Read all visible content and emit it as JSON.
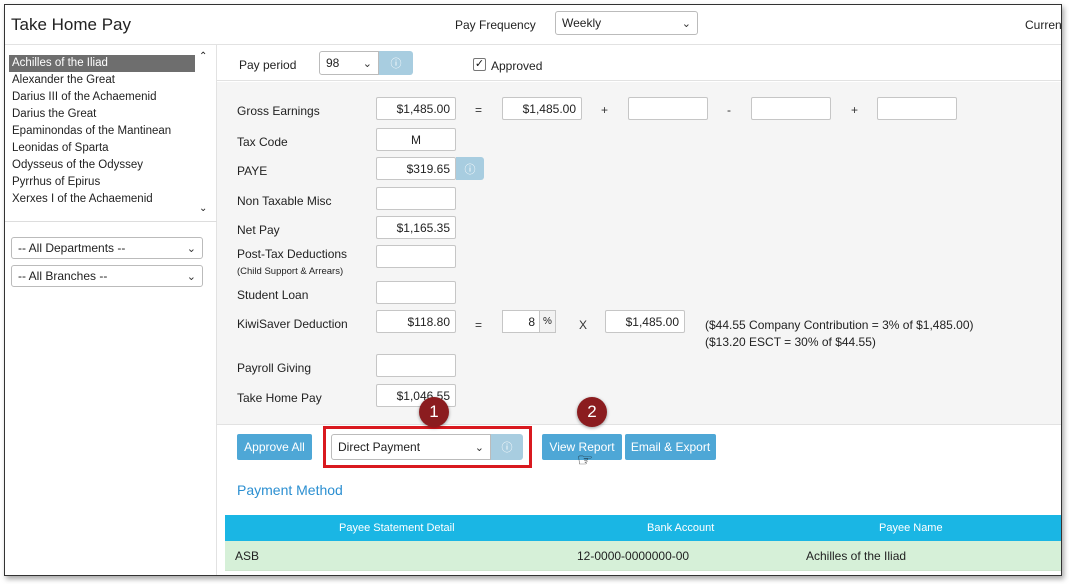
{
  "header": {
    "title": "Take Home Pay",
    "pay_frequency_label": "Pay Frequency",
    "pay_frequency_value": "Weekly",
    "currency_label": "Curren"
  },
  "sidebar": {
    "employees": [
      "Achilles of the Iliad",
      "Alexander the Great",
      "Darius III of the Achaemenid",
      "Darius the Great",
      "Epaminondas of the Mantinean",
      "Leonidas of Sparta",
      "Odysseus of the Odyssey",
      "Pyrrhus of Epirus",
      "Xerxes I of the Achaemenid"
    ],
    "selected_index": 0,
    "department_filter": "-- All Departments --",
    "branch_filter": "-- All Branches --"
  },
  "pay_period": {
    "label": "Pay period",
    "value": "98",
    "approved_label": "Approved",
    "approved": true
  },
  "calc": {
    "gross_earnings": {
      "label": "Gross Earnings",
      "value": "$1,485.00",
      "eq_value": "$1,485.00",
      "add1": "",
      "sub": "",
      "add2": ""
    },
    "tax_code": {
      "label": "Tax Code",
      "value": "M"
    },
    "paye": {
      "label": "PAYE",
      "value": "$319.65"
    },
    "non_taxable_misc": {
      "label": "Non Taxable Misc",
      "value": ""
    },
    "net_pay": {
      "label": "Net Pay",
      "value": "$1,165.35"
    },
    "post_tax_deductions": {
      "label": "Post-Tax Deductions",
      "sublabel": "(Child Support & Arrears)",
      "value": ""
    },
    "student_loan": {
      "label": "Student Loan",
      "value": ""
    },
    "kiwisaver": {
      "label": "KiwiSaver Deduction",
      "value": "$118.80",
      "percent": "8",
      "percent_sign": "%",
      "base": "$1,485.00",
      "note1": "($44.55 Company Contribution = 3% of $1,485.00)",
      "note2": "($13.20 ESCT = 30% of $44.55)"
    },
    "payroll_giving": {
      "label": "Payroll Giving",
      "value": ""
    },
    "take_home_pay": {
      "label": "Take Home Pay",
      "value": "$1,046.55"
    },
    "ops": {
      "eq": "=",
      "plus": "+",
      "minus": "-",
      "times": "X"
    }
  },
  "actions": {
    "approve_all": "Approve All",
    "payment_type": "Direct Payment",
    "view_report": "View Report",
    "email_export": "Email & Export",
    "badge1": "1",
    "badge2": "2"
  },
  "payment_method": {
    "title": "Payment Method",
    "columns": [
      "Payee Statement Detail",
      "Bank Account",
      "Payee Name"
    ],
    "rows": [
      {
        "detail": "ASB",
        "account": "12-0000-0000000-00",
        "name": "Achilles of the Iliad"
      }
    ]
  },
  "icons": {
    "info": "info-circle-icon",
    "chevron": "chevron-down-icon",
    "check": "check-icon",
    "cursor": "hand-pointer-icon"
  },
  "colors": {
    "accent": "#4ea7d6",
    "table_header": "#1ab6e4",
    "row_bg": "#d6f0d8",
    "highlight": "#d9191f",
    "badge": "#8b1c1f"
  }
}
